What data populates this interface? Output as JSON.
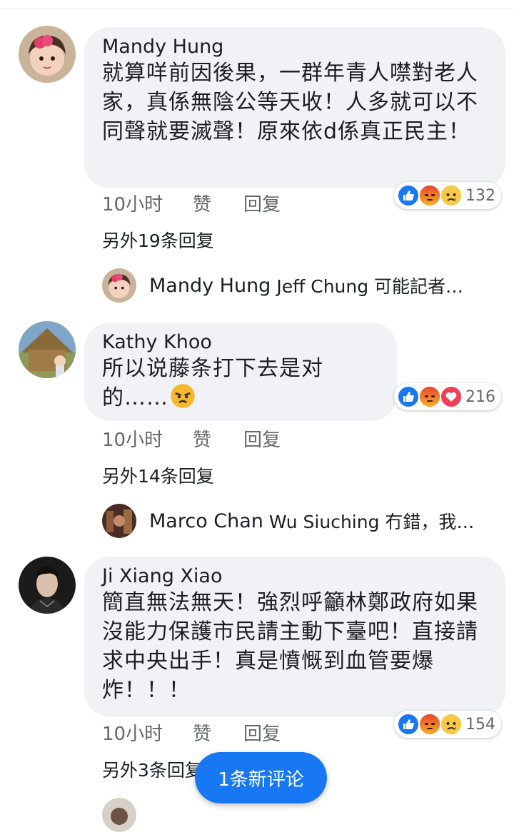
{
  "comments": [
    {
      "author": "Mandy Hung",
      "text": "就算咩前因後果，一群年青人噤對老人家，真係無陰公等天收！人多就可以不同聲就要滅聲！原來依d係真正民主！",
      "time": "10小时",
      "like": "赞",
      "reply": "回复",
      "reaction_count": "132",
      "more_replies": "另外19条回复",
      "latest_reply": {
        "name": "Mandy Hung",
        "text": "Jeff Chung  可能記者…"
      }
    },
    {
      "author": "Kathy Khoo",
      "text": "所以说藤条打下去是对的……",
      "emoji": "angry-face",
      "time": "10小时",
      "like": "赞",
      "reply": "回复",
      "reaction_count": "216",
      "more_replies": "另外14条回复",
      "latest_reply": {
        "name": "Marco Chan",
        "text": "Wu Siuching 冇錯，我…"
      }
    },
    {
      "author": "Ji Xiang Xiao",
      "text": "簡直無法無天！強烈呼籲林鄭政府如果沒能力保護市民請主動下臺吧！直接請求中央出手！真是憤慨到血管要爆炸！！！",
      "time": "10小时",
      "like": "赞",
      "reply": "回复",
      "reaction_count": "154",
      "more_replies": "另外3条回复"
    }
  ],
  "new_comment_button": "1条新评论",
  "colors": {
    "like_blue": "#1877f2",
    "bubble_bg": "#f0f2f5",
    "meta_gray": "#65676b",
    "angry_orange": "#f0612a",
    "love_red": "#f33e58",
    "sad_yellow": "#f7b928"
  }
}
